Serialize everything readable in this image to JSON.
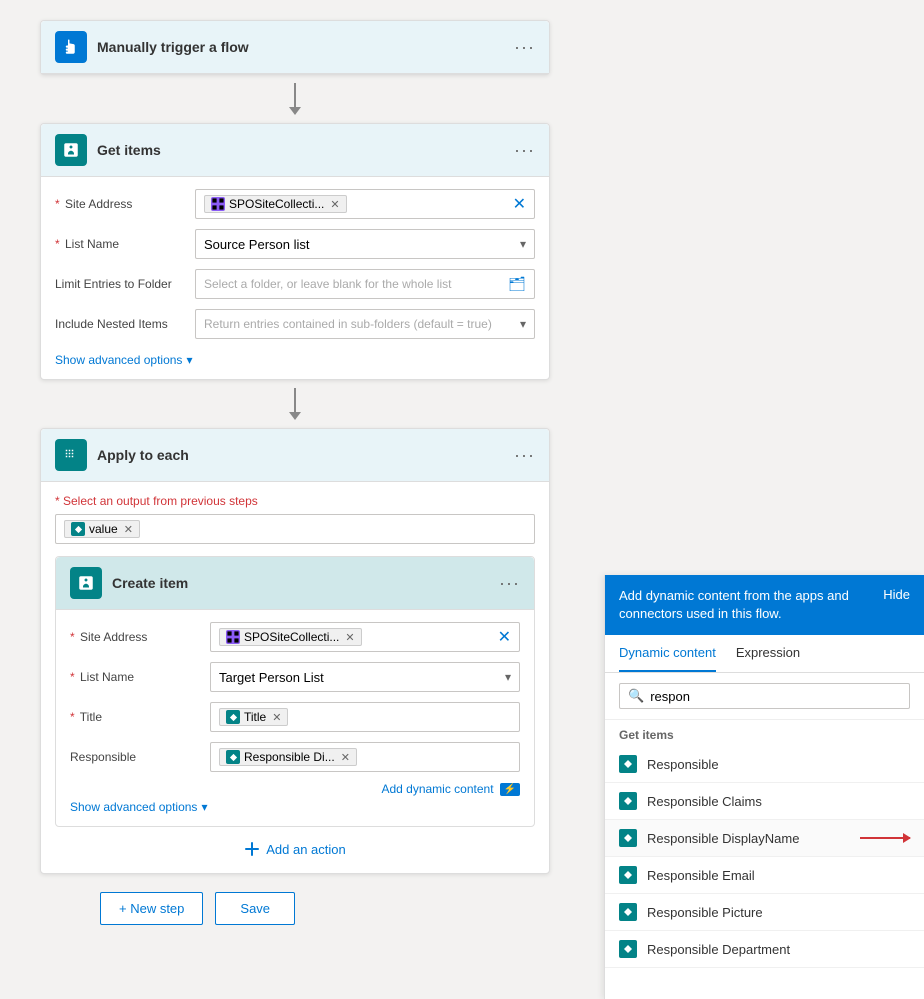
{
  "flow": {
    "trigger": {
      "title": "Manually trigger a flow",
      "icon": "hand-icon"
    },
    "get_items": {
      "title": "Get items",
      "icon": "sharepoint-icon",
      "fields": {
        "site_address": {
          "label": "* Site Address",
          "tag": "SPOSiteCollecti...",
          "required": true
        },
        "list_name": {
          "label": "* List Name",
          "value": "Source Person list",
          "required": true
        },
        "limit_entries": {
          "label": "Limit Entries to Folder",
          "placeholder": "Select a folder, or leave blank for the whole list"
        },
        "include_nested": {
          "label": "Include Nested Items",
          "placeholder": "Return entries contained in sub-folders (default = true)"
        }
      },
      "show_advanced": "Show advanced options"
    },
    "apply_each": {
      "title": "Apply to each",
      "icon": "loop-icon",
      "output_label": "* Select an output from previous steps",
      "output_tag": "value",
      "create_item": {
        "title": "Create item",
        "icon": "sharepoint-icon",
        "fields": {
          "site_address": {
            "label": "* Site Address",
            "tag": "SPOSiteCollecti...",
            "required": true
          },
          "list_name": {
            "label": "* List Name",
            "value": "Target Person List",
            "required": true
          },
          "title_field": {
            "label": "* Title",
            "tag": "Title",
            "required": true
          },
          "responsible": {
            "label": "Responsible",
            "tag": "Responsible Di...",
            "required": false
          }
        },
        "add_dynamic": "Add dynamic content",
        "show_advanced": "Show advanced options"
      }
    },
    "add_action_label": "Add an action",
    "new_step_label": "+ New step",
    "save_label": "Save"
  },
  "dynamic_panel": {
    "header_text": "Add dynamic content from the apps and connectors used in this flow.",
    "hide_label": "Hide",
    "tabs": [
      {
        "label": "Dynamic content",
        "active": true
      },
      {
        "label": "Expression",
        "active": false
      }
    ],
    "search_placeholder": "respon",
    "section_label": "Get items",
    "items": [
      {
        "label": "Responsible",
        "icon": "sp-icon"
      },
      {
        "label": "Responsible Claims",
        "icon": "sp-icon"
      },
      {
        "label": "Responsible DisplayName",
        "icon": "sp-icon",
        "has_arrow": true
      },
      {
        "label": "Responsible Email",
        "icon": "sp-icon"
      },
      {
        "label": "Responsible Picture",
        "icon": "sp-icon"
      },
      {
        "label": "Responsible Department",
        "icon": "sp-icon"
      }
    ]
  },
  "icons": {
    "search": "🔍",
    "chevron_down": "▾",
    "more": "···",
    "close": "✕",
    "folder": "📁",
    "loop": "↻",
    "plus": "+"
  }
}
